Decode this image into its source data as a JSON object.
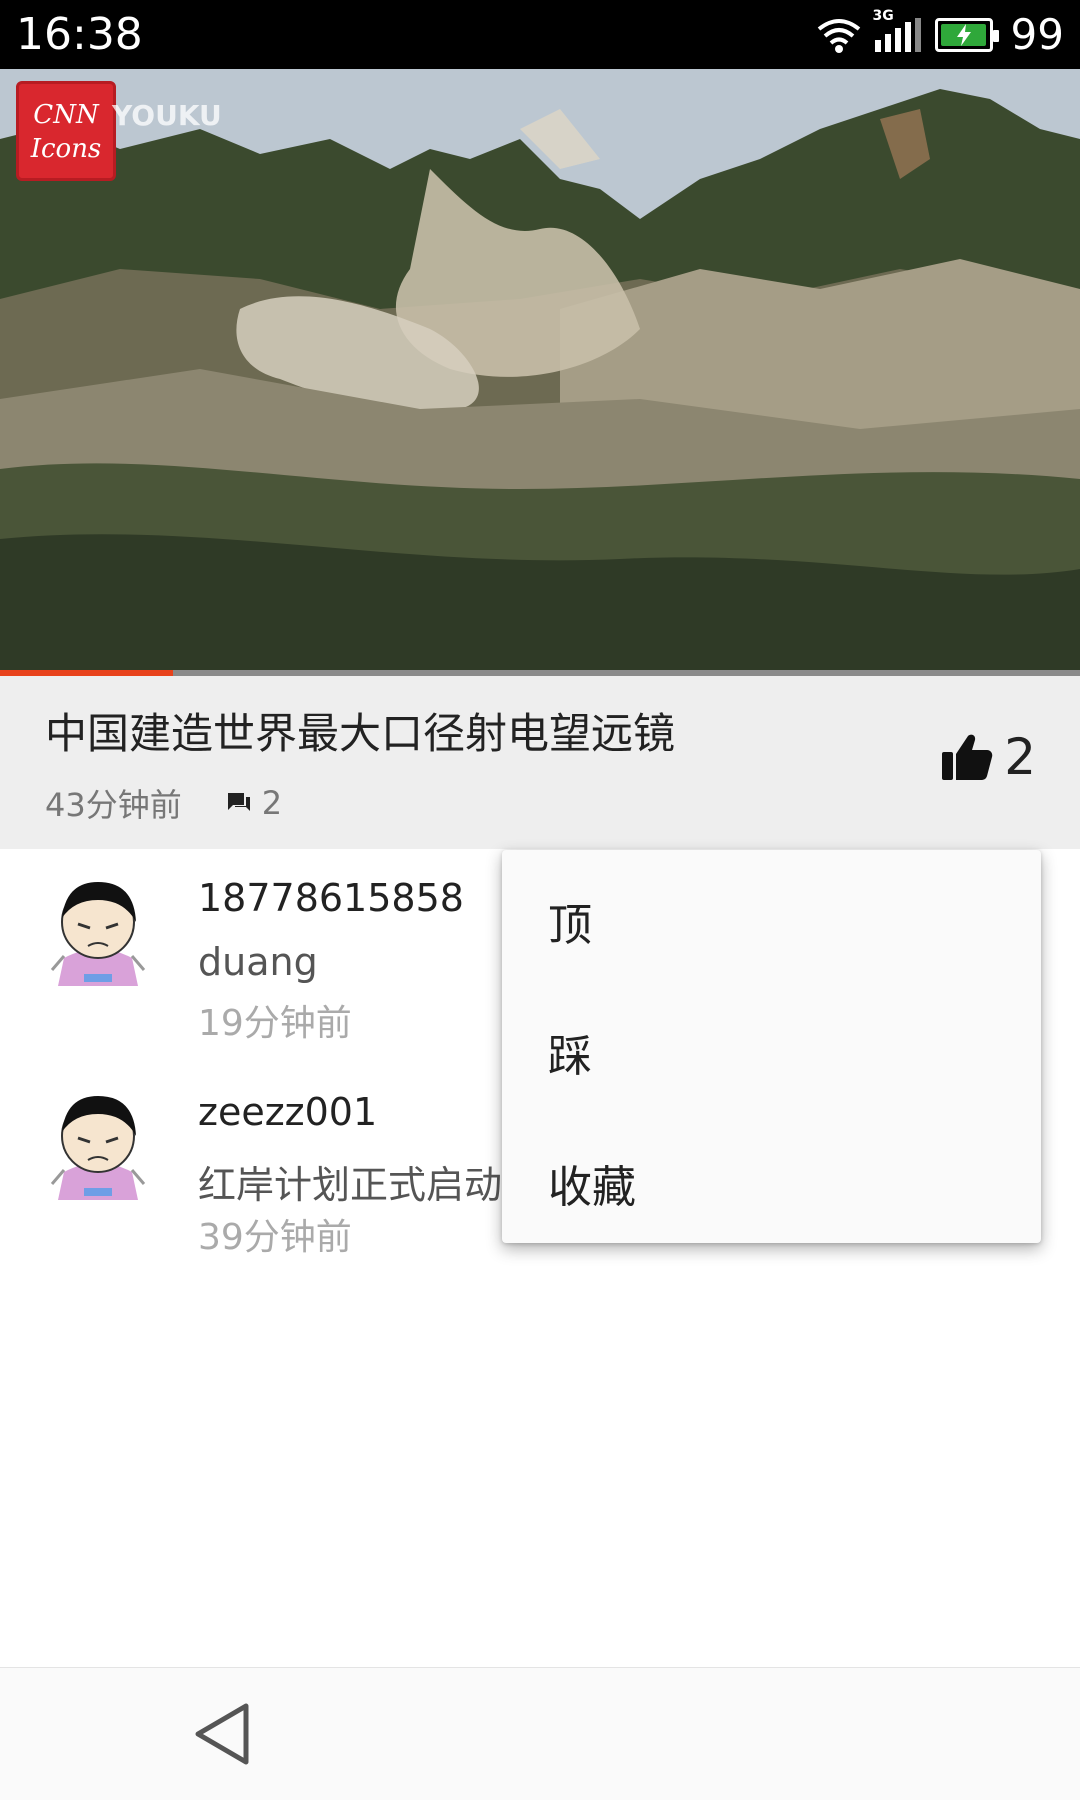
{
  "status_bar": {
    "time": "16:38",
    "battery_level": "99",
    "battery_fraction": 0.99,
    "network_type": "3G",
    "icons": [
      "wifi-icon",
      "signal-icon",
      "battery-icon"
    ]
  },
  "video": {
    "logo_text": "CNN Icons",
    "watermark": "YOUKU",
    "progress_fraction": 0.16,
    "progress_color": "#e8421c"
  },
  "post": {
    "title": "中国建造世界最大口径射电望远镜",
    "time_ago": "43分钟前",
    "comment_count": "2",
    "like_count": "2"
  },
  "comments": [
    {
      "user": "18778615858",
      "text": "duang",
      "time": "19分钟前"
    },
    {
      "user": "zeezz001",
      "text": "红岸计划正式启动",
      "time": "39分钟前"
    }
  ],
  "popup_menu": {
    "items": [
      {
        "label": "顶"
      },
      {
        "label": "踩"
      },
      {
        "label": "收藏"
      }
    ]
  },
  "nav_bar": {
    "icons": [
      "back-icon"
    ]
  }
}
